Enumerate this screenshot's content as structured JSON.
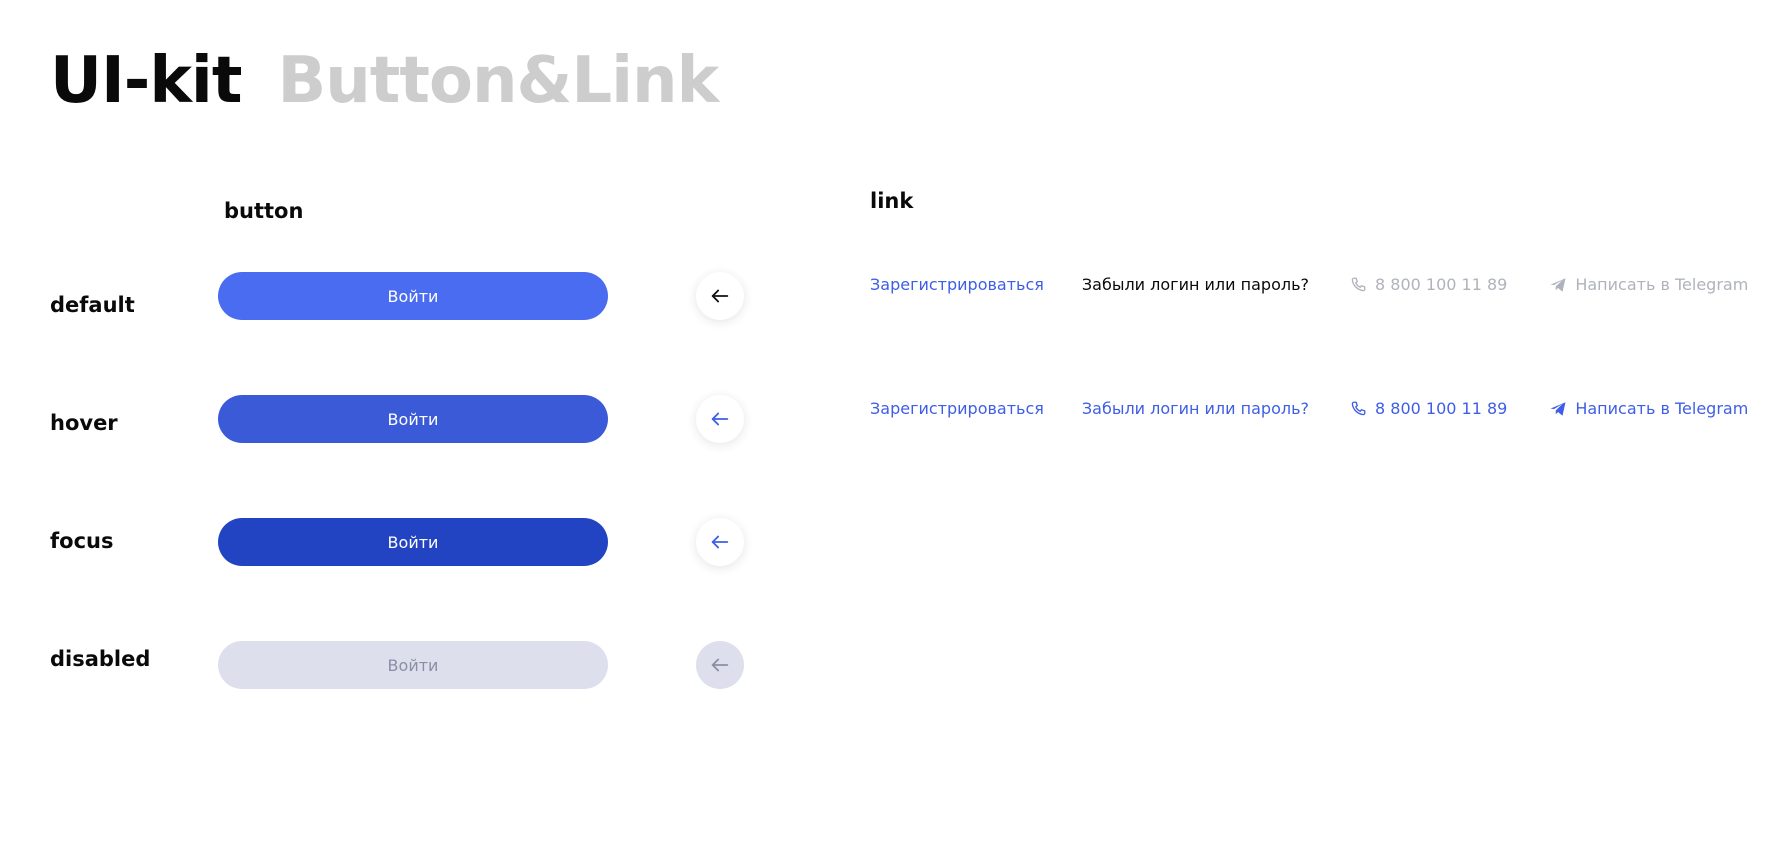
{
  "header": {
    "title": "UI-kit",
    "subtitle": "Button&Link"
  },
  "button_section": {
    "heading": "button",
    "states": [
      {
        "state": "default",
        "label": "Войти",
        "icon": "arrow-left-icon"
      },
      {
        "state": "hover",
        "label": "Войти",
        "icon": "arrow-left-icon"
      },
      {
        "state": "focus",
        "label": "Войти",
        "icon": "arrow-left-icon"
      },
      {
        "state": "disabled",
        "label": "Войти",
        "icon": "arrow-left-icon"
      }
    ]
  },
  "link_section": {
    "heading": "link",
    "rows": [
      {
        "register": "Зарегистрироваться",
        "forgot": "Забыли логин или пароль?",
        "phone": "8 800 100 11 89",
        "telegram": "Написать в Telegram"
      },
      {
        "register": "Зарегистрироваться",
        "forgot": "Забыли логин или пароль?",
        "phone": "8 800 100 11 89",
        "telegram": "Написать в Telegram"
      }
    ]
  },
  "colors": {
    "default": "#4a6cf0",
    "hover": "#3b5ad8",
    "focus": "#2244c2",
    "disabled": "#dde0ec",
    "link": "#3e5ee6",
    "muted": "#b0b3bc"
  }
}
